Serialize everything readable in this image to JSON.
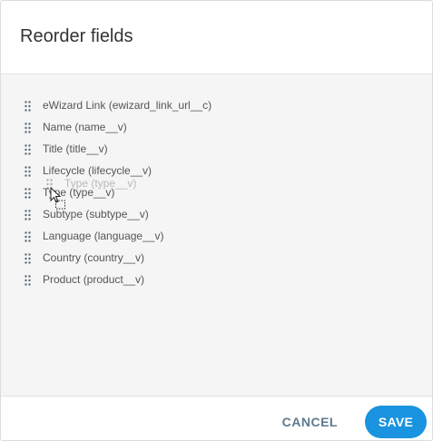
{
  "dialog": {
    "title": "Reorder fields",
    "fields": [
      {
        "label": "eWizard Link (ewizard_link_url__c)"
      },
      {
        "label": "Name (name__v)"
      },
      {
        "label": "Title (title__v)"
      },
      {
        "label": "Lifecycle (lifecycle__v)"
      },
      {
        "label": "Type (type__v)"
      },
      {
        "label": "Subtype (subtype__v)"
      },
      {
        "label": "Language (language__v)"
      },
      {
        "label": "Country (country__v)"
      },
      {
        "label": "Product (product__v)"
      }
    ],
    "drag_ghost": {
      "label": "Type (type__v)"
    },
    "cancel_label": "CANCEL",
    "save_label": "SAVE"
  },
  "colors": {
    "primary": "#1a93e0",
    "cancel_text": "#5f7a8c",
    "body_bg": "#f5f5f5"
  },
  "icons": {
    "row_handle": "drag-handle-icon",
    "cursor": "drag-cursor-icon"
  }
}
